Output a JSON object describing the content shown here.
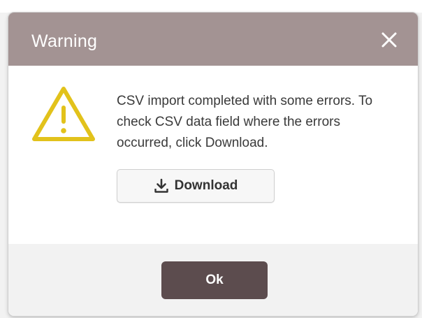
{
  "dialog": {
    "title": "Warning",
    "close_icon": "close-icon",
    "warning_icon": "warning-triangle-icon",
    "message": "CSV import completed with some errors. To check CSV data field where the errors occurred, click Download.",
    "download_button": {
      "label": "Download",
      "icon": "download-icon"
    },
    "ok_button": {
      "label": "Ok"
    }
  },
  "colors": {
    "header_background": "#a39393",
    "ok_button_background": "#5c4c4e",
    "warning_icon": "#e2c21b",
    "footer_background": "#f2f2f2"
  }
}
